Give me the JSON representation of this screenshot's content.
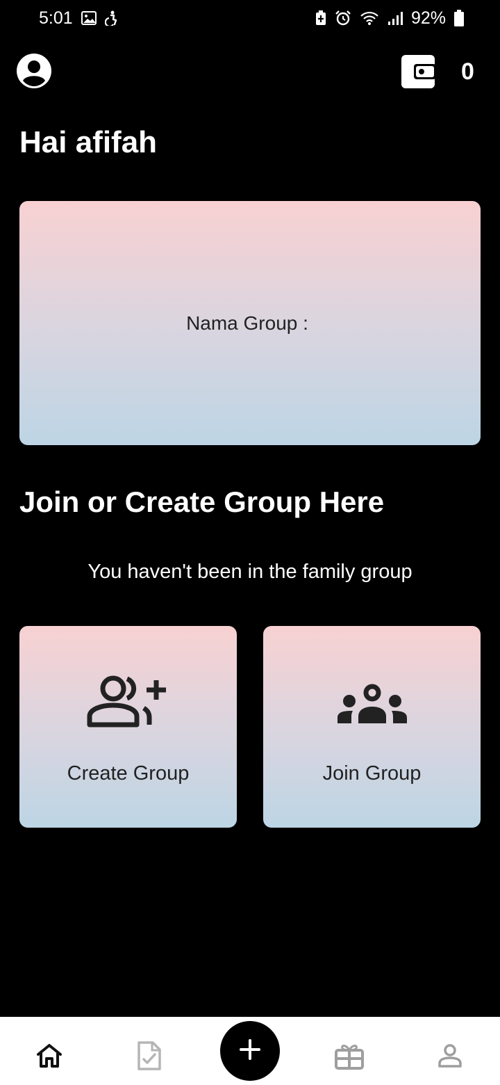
{
  "status_bar": {
    "time": "5:01",
    "battery": "92%",
    "left_icons": [
      "image-icon",
      "accessibility-icon"
    ],
    "right_icons": [
      "battery-saver-icon",
      "alarm-icon",
      "wifi-icon",
      "signal-icon",
      "battery-icon"
    ]
  },
  "header": {
    "avatar_icon": "account-circle-icon",
    "wallet_icon": "wallet-icon",
    "wallet_balance": "0"
  },
  "greeting": "Hai afifah",
  "group_card": {
    "label": "Nama Group :",
    "value": ""
  },
  "section": {
    "title": "Join or Create Group Here",
    "notice": "You haven't been in the family group"
  },
  "actions": [
    {
      "label": "Create Group",
      "icon": "person-add-icon"
    },
    {
      "label": "Join Group",
      "icon": "groups-icon"
    }
  ],
  "bottom_nav": {
    "items": [
      {
        "name": "home",
        "icon": "home-icon",
        "active": true
      },
      {
        "name": "tasks",
        "icon": "task-document-icon",
        "active": false
      },
      {
        "name": "add",
        "icon": "plus-icon",
        "active": false
      },
      {
        "name": "rewards",
        "icon": "gift-box-icon",
        "active": false
      },
      {
        "name": "profile",
        "icon": "person-icon",
        "active": false
      }
    ]
  },
  "colors": {
    "background": "#000000",
    "card_gradient_top": "#f8d1d2",
    "card_gradient_bottom": "#bdd5e5",
    "nav_background": "#ffffff",
    "nav_inactive": "#9e9e9e"
  }
}
